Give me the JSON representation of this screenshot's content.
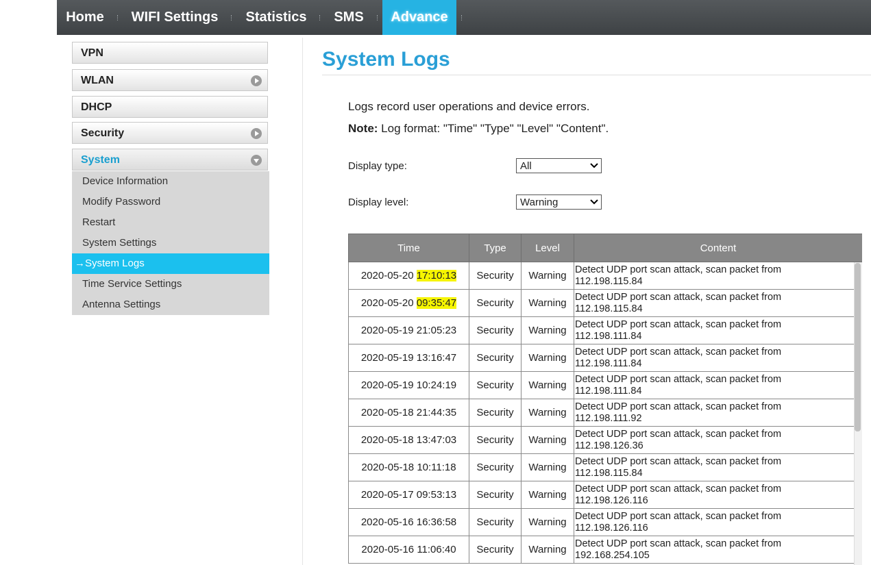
{
  "nav": {
    "items": [
      "Home",
      "WIFI Settings",
      "Statistics",
      "SMS",
      "Advance"
    ],
    "active": "Advance"
  },
  "sidebar": {
    "sections": [
      "VPN",
      "WLAN",
      "DHCP",
      "Security",
      "System"
    ],
    "system_items": [
      "Device Information",
      "Modify Password",
      "Restart",
      "System Settings",
      "System Logs",
      "Time Service Settings",
      "Antenna Settings"
    ],
    "active_item": "System Logs",
    "active_arrow": "→"
  },
  "main": {
    "title": "System Logs",
    "description": "Logs record user operations and device errors.",
    "note_label": "Note:",
    "note_text": " Log format: \"Time\" \"Type\" \"Level\" \"Content\".",
    "display_type_label": "Display type:",
    "display_type_value": "All",
    "display_level_label": "Display level:",
    "display_level_value": "Warning"
  },
  "table": {
    "headers": [
      "Time",
      "Type",
      "Level",
      "Content"
    ],
    "rows": [
      {
        "date": "2020-05-20",
        "clock": "17:10:13",
        "highlight": true,
        "type": "Security",
        "level": "Warning",
        "content1": "Detect UDP port scan attack, scan packet from",
        "content2": "112.198.115.84"
      },
      {
        "date": "2020-05-20",
        "clock": "09:35:47",
        "highlight": true,
        "type": "Security",
        "level": "Warning",
        "content1": "Detect UDP port scan attack, scan packet from",
        "content2": "112.198.115.84"
      },
      {
        "date": "2020-05-19",
        "clock": "21:05:23",
        "highlight": false,
        "type": "Security",
        "level": "Warning",
        "content1": "Detect UDP port scan attack, scan packet from",
        "content2": "112.198.111.84"
      },
      {
        "date": "2020-05-19",
        "clock": "13:16:47",
        "highlight": false,
        "type": "Security",
        "level": "Warning",
        "content1": "Detect UDP port scan attack, scan packet from",
        "content2": "112.198.111.84"
      },
      {
        "date": "2020-05-19",
        "clock": "10:24:19",
        "highlight": false,
        "type": "Security",
        "level": "Warning",
        "content1": "Detect UDP port scan attack, scan packet from",
        "content2": "112.198.111.84"
      },
      {
        "date": "2020-05-18",
        "clock": "21:44:35",
        "highlight": false,
        "type": "Security",
        "level": "Warning",
        "content1": "Detect UDP port scan attack, scan packet from",
        "content2": "112.198.111.92"
      },
      {
        "date": "2020-05-18",
        "clock": "13:47:03",
        "highlight": false,
        "type": "Security",
        "level": "Warning",
        "content1": "Detect UDP port scan attack, scan packet from",
        "content2": "112.198.126.36"
      },
      {
        "date": "2020-05-18",
        "clock": "10:11:18",
        "highlight": false,
        "type": "Security",
        "level": "Warning",
        "content1": "Detect UDP port scan attack, scan packet from",
        "content2": "112.198.115.84"
      },
      {
        "date": "2020-05-17",
        "clock": "09:53:13",
        "highlight": false,
        "type": "Security",
        "level": "Warning",
        "content1": "Detect UDP port scan attack, scan packet from",
        "content2": "112.198.126.116"
      },
      {
        "date": "2020-05-16",
        "clock": "16:36:58",
        "highlight": false,
        "type": "Security",
        "level": "Warning",
        "content1": "Detect UDP port scan attack, scan packet from",
        "content2": "112.198.126.116"
      },
      {
        "date": "2020-05-16",
        "clock": "11:06:40",
        "highlight": false,
        "type": "Security",
        "level": "Warning",
        "content1": "Detect UDP port scan attack, scan packet from",
        "content2": "192.168.254.105"
      }
    ]
  },
  "colors": {
    "nav_active": "#26b3e3",
    "title": "#2a9fd6",
    "highlight": "#f6f500"
  }
}
